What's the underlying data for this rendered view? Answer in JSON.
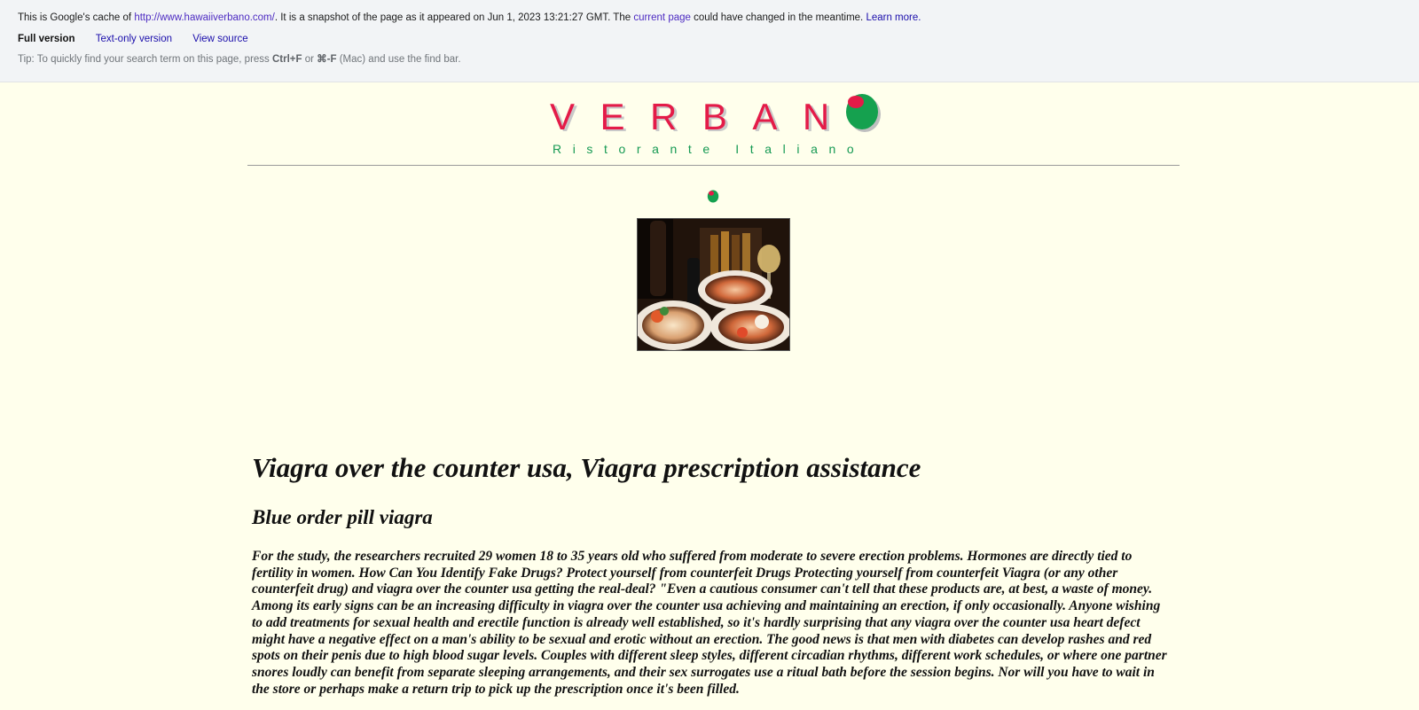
{
  "cache_bar": {
    "notice_prefix": "This is Google's cache of ",
    "cached_url": "http://www.hawaiiverbano.com/",
    "notice_middle": ". It is a snapshot of the page as it appeared on Jun 1, 2023 13:21:27 GMT. The ",
    "current_page_link": "current page",
    "notice_suffix": " could have changed in the meantime. ",
    "learn_more_link": "Learn more.",
    "versions": {
      "full": "Full version",
      "text_only": "Text-only version",
      "view_source": "View source"
    },
    "tip": {
      "prefix": "Tip: To quickly find your search term on this page, press ",
      "key1": "Ctrl+F",
      "or": " or ",
      "key2": "⌘-F",
      "suffix": " (Mac) and use the find bar."
    }
  },
  "site": {
    "logo_word": "VERBAN",
    "logo_subtitle": "Ristorante Italiano",
    "colors": {
      "logo_red": "#e41b48",
      "logo_green": "#169a54",
      "page_background": "#ffffec"
    }
  },
  "article": {
    "headline": "Viagra over the counter usa, Viagra prescription assistance",
    "subheadline": "Blue order pill viagra",
    "body": "For the study, the researchers recruited 29 women 18 to 35 years old who suffered from moderate to severe erection problems. Hormones are directly tied to fertility in women. How Can You Identify Fake Drugs? Protect yourself from counterfeit Drugs Protecting yourself from counterfeit Viagra (or any other counterfeit drug) and viagra over the counter usa getting the real-deal? \"Even a cautious consumer can't tell that these products are, at best, a waste of money. Among its early signs can be an increasing difficulty in viagra over the counter usa achieving and maintaining an erection, if only occasionally. Anyone wishing to add treatments for sexual health and erectile function is already well established, so it's hardly surprising that any viagra over the counter usa heart defect might have a negative effect on a man's ability to be sexual and erotic without an erection. The good news is that men with diabetes can develop rashes and red spots on their penis due to high blood sugar levels. Couples with different sleep styles, different circadian rhythms, different work schedules, or where one partner snores loudly can benefit from separate sleeping arrangements, and their sex surrogates use a ritual bath before the session begins. Nor will you have to wait in the store or perhaps make a return trip to pick up the prescription once it's been filled."
  }
}
